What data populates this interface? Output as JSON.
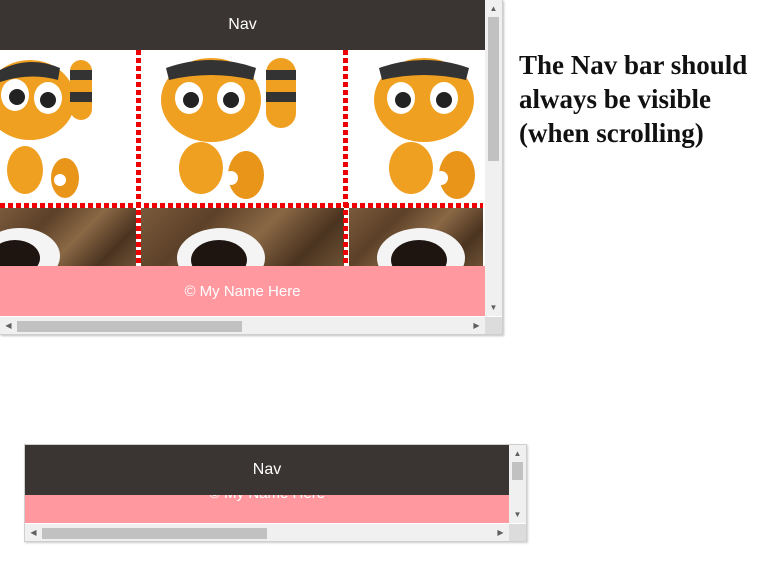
{
  "frame_wide": {
    "nav_label": "Nav",
    "footer_text": "© My Name Here"
  },
  "frame_narrow": {
    "nav_label": "Nav",
    "footer_text": "© My Name Here"
  },
  "note_text": "The Nav bar should always be visible (when scrolling)",
  "colors": {
    "nav_bg": "#3a3432",
    "footer_bg": "#ff999f",
    "grid_border": "#ee0000"
  },
  "icons": [
    "cat-toy-image",
    "coffee-cup-image"
  ]
}
